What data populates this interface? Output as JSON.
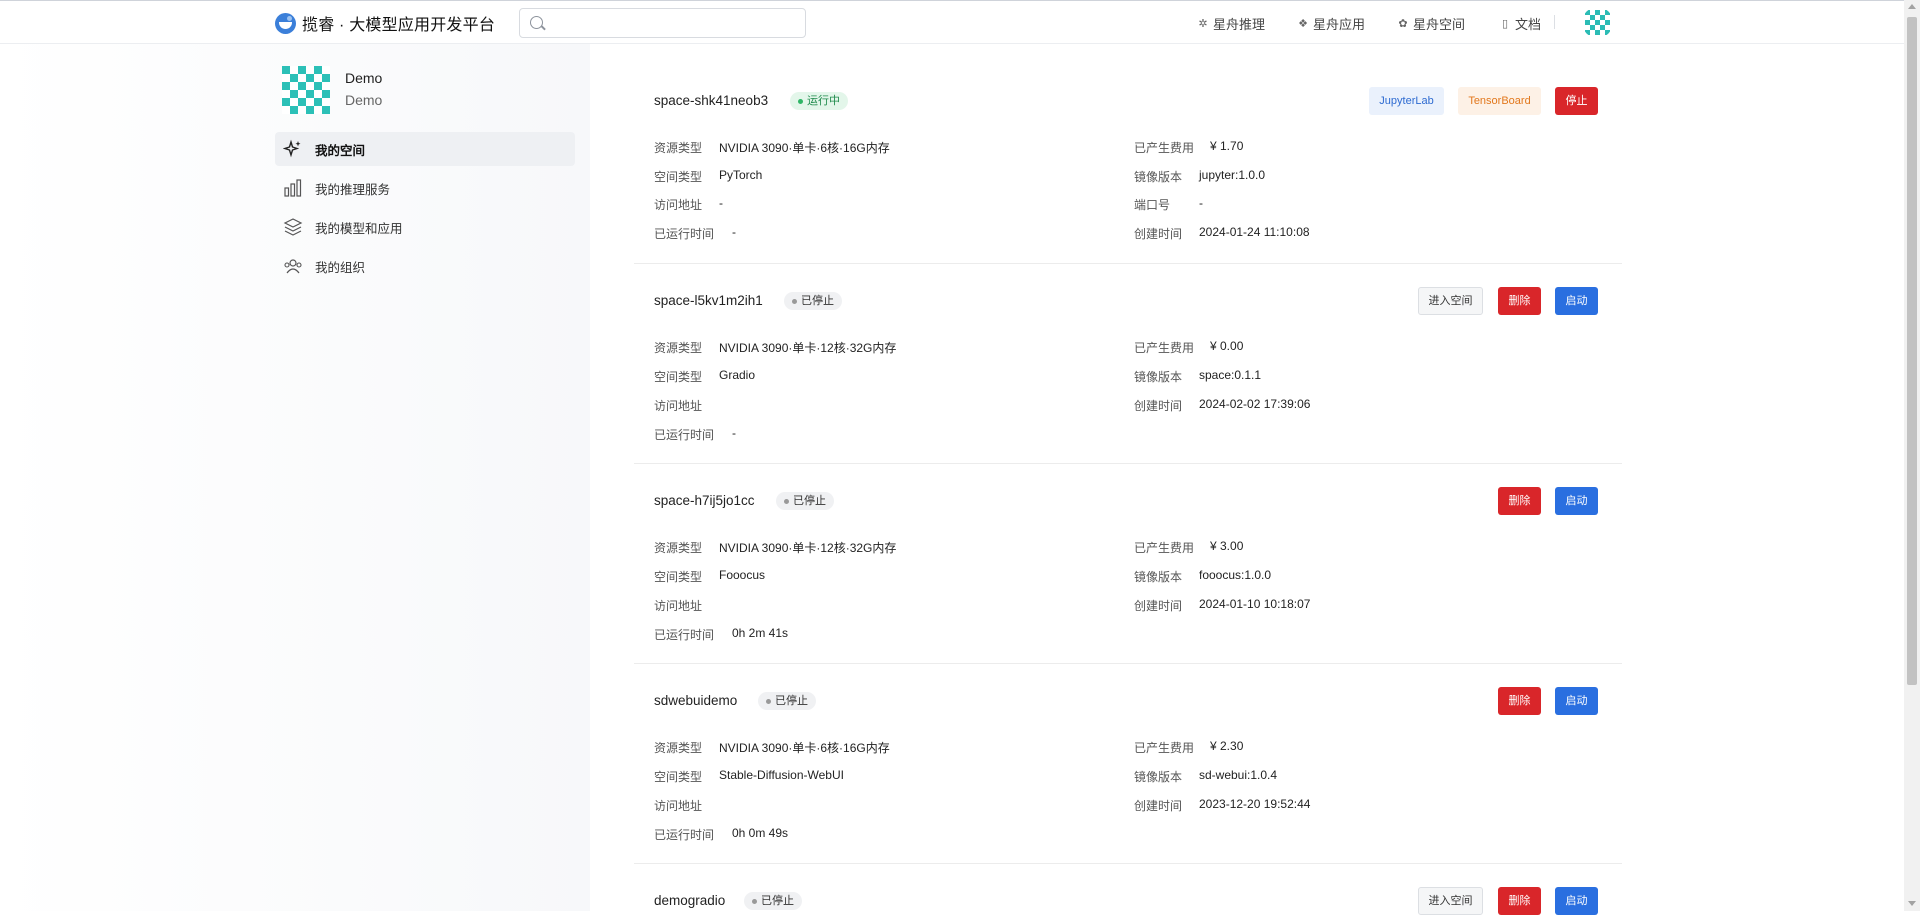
{
  "app": {
    "brand": "揽睿 · 大模型应用开发平台"
  },
  "search": {
    "placeholder": ""
  },
  "nav": {
    "items": [
      {
        "label": "星舟推理",
        "icon": "sparkle-icon"
      },
      {
        "label": "星舟应用",
        "icon": "apps-icon"
      },
      {
        "label": "星舟空间",
        "icon": "spaces-icon"
      },
      {
        "label": "文档",
        "icon": "doc-icon"
      }
    ]
  },
  "profile": {
    "name": "Demo",
    "sub": "Demo"
  },
  "sidebar": {
    "items": [
      {
        "label": "我的空间",
        "icon": "sparkles-icon",
        "active": true
      },
      {
        "label": "我的推理服务",
        "icon": "bar-chart-icon",
        "active": false
      },
      {
        "label": "我的模型和应用",
        "icon": "layers-icon",
        "active": false
      },
      {
        "label": "我的组织",
        "icon": "users-icon",
        "active": false
      }
    ]
  },
  "labels": {
    "resource_type": "资源类型",
    "space_type": "空间类型",
    "access_url": "访问地址",
    "run_time": "已运行时间",
    "cost": "已产生费用",
    "image_version": "镜像版本",
    "port": "端口号",
    "created": "创建时间"
  },
  "buttons": {
    "jupyter": "JupyterLab",
    "tensorboard": "TensorBoard",
    "stop": "停止",
    "enter": "进入空间",
    "delete": "删除",
    "start": "启动"
  },
  "spaces": [
    {
      "name": "space-shk41neob3",
      "status": "运行中",
      "resource": "NVIDIA 3090·单卡·6核·16G内存",
      "space_type": "PyTorch",
      "access_url": "-",
      "run_time": "-",
      "cost": "¥ 1.70",
      "image": "jupyter:1.0.0",
      "port": "-",
      "created": "2024-01-24 11:10:08"
    },
    {
      "name": "space-l5kv1m2ih1",
      "status": "已停止",
      "resource": "NVIDIA 3090·单卡·12核·32G内存",
      "space_type": "Gradio",
      "access_url": "",
      "run_time": "-",
      "cost": "¥ 0.00",
      "image": "space:0.1.1",
      "created": "2024-02-02 17:39:06"
    },
    {
      "name": "space-h7ij5jo1cc",
      "status": "已停止",
      "resource": "NVIDIA 3090·单卡·12核·32G内存",
      "space_type": "Fooocus",
      "access_url": "",
      "run_time": "0h 2m 41s",
      "cost": "¥ 3.00",
      "image": "fooocus:1.0.0",
      "created": "2024-01-10 10:18:07"
    },
    {
      "name": "sdwebuidemo",
      "status": "已停止",
      "resource": "NVIDIA 3090·单卡·6核·16G内存",
      "space_type": "Stable-Diffusion-WebUI",
      "access_url": "",
      "run_time": "0h 0m 49s",
      "cost": "¥ 2.30",
      "image": "sd-webui:1.0.4",
      "created": "2023-12-20 19:52:44"
    },
    {
      "name": "demogradio",
      "status": "已停止"
    }
  ],
  "colors": {
    "primary": "#2a6fe0",
    "danger": "#d9262a",
    "running": "#2fb566"
  }
}
